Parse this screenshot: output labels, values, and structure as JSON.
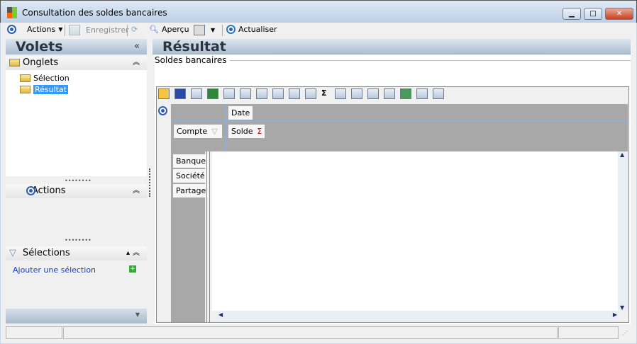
{
  "window": {
    "title": "Consultation des soldes bancaires",
    "minimize": "▁",
    "maximize": "□",
    "close": "✕"
  },
  "toolbar": {
    "actions": "Actions",
    "enregistrer": "Enregistrer",
    "apercu": "Aperçu",
    "actualiser": "Actualiser"
  },
  "left": {
    "title": "Volets",
    "collapse": "«",
    "onglets": {
      "label": "Onglets",
      "items": [
        "Sélection",
        "Résultat"
      ],
      "selected": "Résultat"
    },
    "actions": {
      "label": "Actions"
    },
    "selections": {
      "label": "Sélections",
      "add_link": "Ajouter une sélection"
    }
  },
  "right": {
    "title": "Résultat",
    "group": "Soldes bancaires",
    "pivot": {
      "column_fields": [
        "Date"
      ],
      "filter_fields": [
        "Compte"
      ],
      "data_fields": [
        "Solde"
      ],
      "row_fields": [
        "Banque",
        "Société",
        "Partage"
      ],
      "sigma": "Σ"
    }
  },
  "colors": {
    "accent": "#2a5db0",
    "selection": "#3399ff",
    "pivot_grey": "#a8a8a8"
  }
}
